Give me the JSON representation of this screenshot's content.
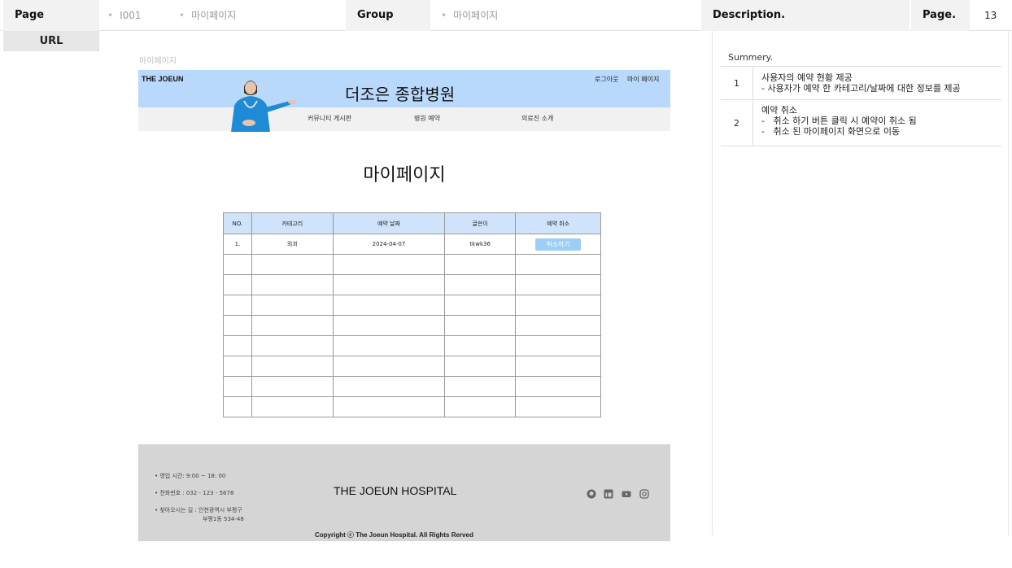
{
  "header": {
    "page_label": "Page",
    "page_id": "I001",
    "page_name": "마이페이지",
    "group_label": "Group",
    "group_name": "마이페이지",
    "description_label": "Description.",
    "page_no_label": "Page.",
    "page_no": "13",
    "url_label": "URL"
  },
  "mockup": {
    "title": "마이페이지",
    "brand": "THE JOEUN",
    "hospital_name": "더조은 종합병원",
    "logout": "로그아웃",
    "mypage_link": "마이 페이지",
    "nav": [
      "커뮤니티 게시판",
      "병원 예약",
      "의료진 소개"
    ],
    "heading": "마이페이지",
    "table": {
      "columns": [
        "NO.",
        "카테고리",
        "예약 날짜",
        "글쓴이",
        "예약 취소"
      ],
      "rows": [
        {
          "no": "1.",
          "category": "외과",
          "date": "2024-04-07",
          "writer": "tkwk36",
          "action": "취소하기"
        }
      ],
      "empty_rows": 8
    },
    "footer": {
      "hours": "영업 시간: 9:00 ~ 18: 00",
      "phone": "전화번호 : 032 - 123 - 5678",
      "addr1": "찾아오시는 길 : 인천광역시 부평구",
      "addr2": "부평1동 534-48",
      "name": "THE JOEUN HOSPITAL",
      "copyright": "Copyright ⓒ The Joeun Hospital. All Rights Rerved",
      "social_icons": [
        "github-icon",
        "linkedin-icon",
        "youtube-icon",
        "instagram-icon"
      ]
    }
  },
  "description": {
    "summary_label": "Summery.",
    "items": [
      {
        "num": "1",
        "text": "사용자의 예약 현황 제공\n- 사용자가 예약 한 카테고리/날짜에 대한 정보를 제공"
      },
      {
        "num": "2",
        "text": "예약 취소\n-   취소 하기 버튼 클릭 시 예약이 취소 됨\n-   취소 된 마이페이지 화면으로 이동"
      }
    ]
  },
  "colors": {
    "site_header": "#b9d9fc",
    "table_header": "#cfe4fa",
    "cancel_button": "#9ccdf5",
    "footer": "#d5d5d5"
  }
}
